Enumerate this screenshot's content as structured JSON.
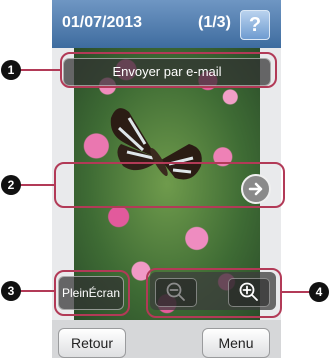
{
  "header": {
    "date": "01/07/2013",
    "counter": "(1/3)",
    "help_label": "?"
  },
  "overlay": {
    "email_button": "Envoyer par e-mail",
    "fullscreen_button": "PleinÉcran"
  },
  "footer": {
    "back_button": "Retour",
    "menu_button": "Menu"
  },
  "callouts": [
    "1",
    "2",
    "3",
    "4"
  ],
  "icons": {
    "next": "chevron-right-icon",
    "zoom_out": "zoom-out-icon",
    "zoom_in": "zoom-in-icon"
  },
  "colors": {
    "header": "#4f7db3",
    "callout_frame": "#b23a57",
    "callout_number": "#111111"
  }
}
